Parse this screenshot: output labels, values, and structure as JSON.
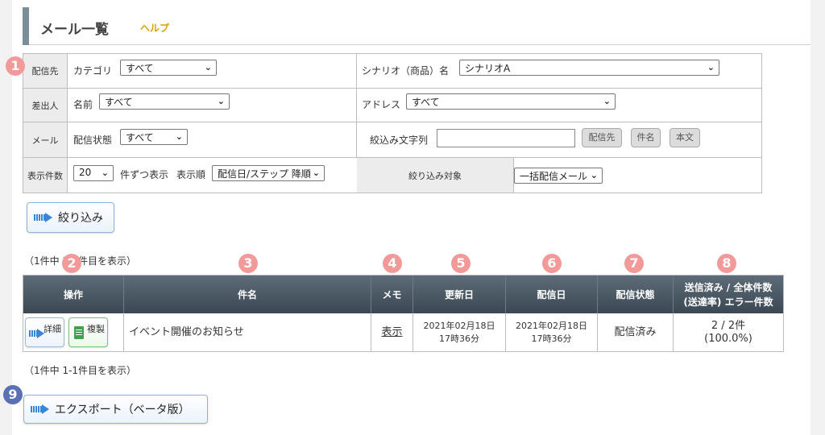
{
  "header": {
    "title": "メール一覧",
    "help_label": "ヘルプ"
  },
  "badges": [
    "1",
    "2",
    "3",
    "4",
    "5",
    "6",
    "7",
    "8",
    "9"
  ],
  "filters": {
    "row1": {
      "head": "配信先",
      "category_label": "カテゴリ",
      "category_value": "すべて",
      "scenario_label": "シナリオ（商品）名",
      "scenario_value": "シナリオA"
    },
    "row2": {
      "head": "差出人",
      "name_label": "名前",
      "name_value": "すべて",
      "address_label": "アドレス",
      "address_value": "すべて"
    },
    "row3": {
      "head": "メール",
      "status_label": "配信状態",
      "status_value": "すべて",
      "search_label": "絞込み文字列",
      "search_value": "",
      "btn_recipient": "配信先",
      "btn_subject": "件名",
      "btn_body": "本文"
    },
    "row4": {
      "head": "表示件数",
      "per_page_value": "20",
      "per_page_suffix": "件ずつ表示",
      "order_label": "表示順",
      "order_value": "配信日/ステップ 降順",
      "target_label": "絞り込み対象",
      "target_value": "一括配信メール"
    }
  },
  "filter_button": "絞り込み",
  "count_top": "（1件中 1-1件目を表示）",
  "count_bottom": "（1件中 1-1件目を表示）",
  "table": {
    "headers": {
      "ops": "操作",
      "subject": "件名",
      "memo": "メモ",
      "updated": "更新日",
      "sent": "配信日",
      "status": "配信状態",
      "counts_line1": "送信済み / 全体件数",
      "counts_line2": "(送達率) エラー件数"
    },
    "rows": [
      {
        "detail_label": "詳細",
        "copy_label": "複製",
        "subject": "イベント開催のお知らせ",
        "memo": "表示",
        "updated_date": "2021年02月18日",
        "updated_time": "17時36分",
        "sent_date": "2021年02月18日",
        "sent_time": "17時36分",
        "status": "配信済み",
        "counts": "2 / 2件",
        "rate": "(100.0%)"
      }
    ]
  },
  "export_button": "エクスポート（ベータ版）",
  "colors": {
    "badge": "#f29a9a",
    "badge_blue": "#5b6fb4",
    "help": "#e0a000",
    "header_dark": "#3b4853"
  }
}
